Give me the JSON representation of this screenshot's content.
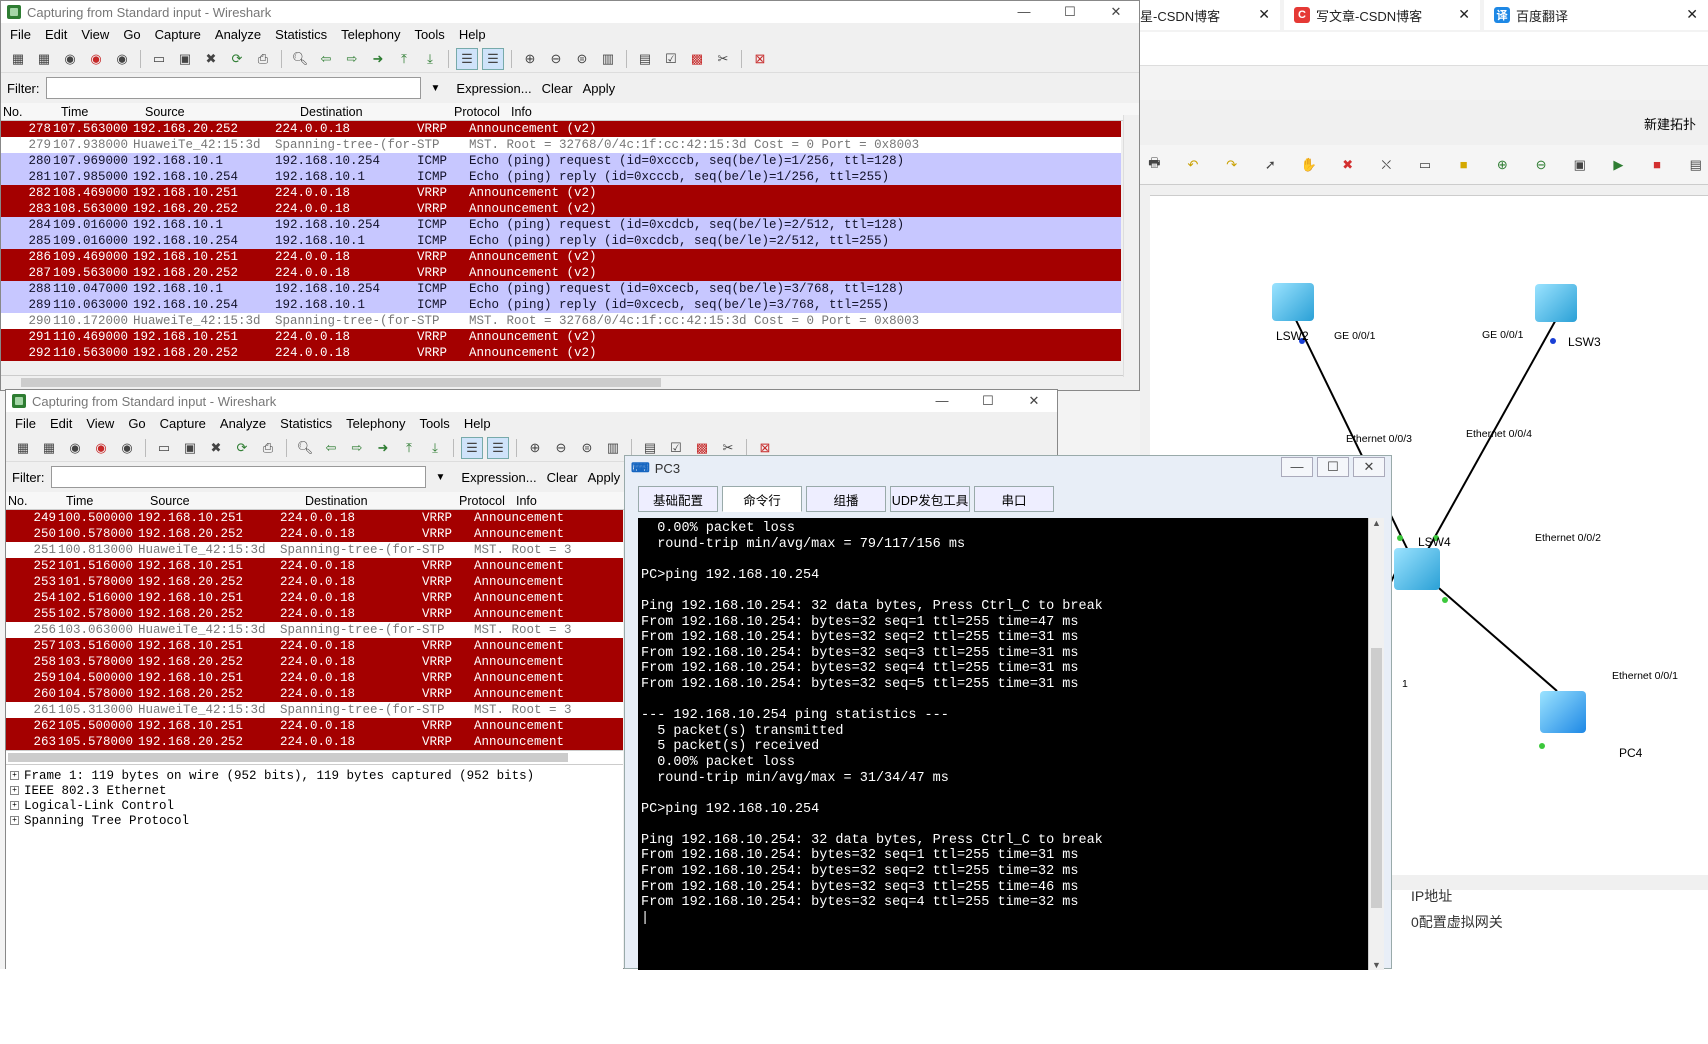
{
  "browser": {
    "tabs": [
      {
        "label": "星-CSDN博客"
      },
      {
        "label": "写文章-CSDN博客",
        "icon_text": "C",
        "icon_color": "#e53935"
      },
      {
        "label": "百度翻译",
        "icon_text": "译",
        "icon_color": "#1e88e5"
      }
    ],
    "close_glyph": "✕"
  },
  "ensp": {
    "new_topo": "新建拓扑",
    "devices": [
      {
        "name": "LSW2"
      },
      {
        "name": "LSW3"
      },
      {
        "name": "LSW4"
      },
      {
        "name": "PC4"
      }
    ],
    "ports": [
      "GE 0/0/1",
      "GE 0/0/1",
      "Ethernet 0/0/3",
      "Ethernet 0/0/4",
      "Ethernet 0/0/2",
      "Ethernet 0/0/1",
      "1"
    ],
    "bottom_texts": [
      "IP地址",
      "0配置虚拟网关"
    ]
  },
  "ws1": {
    "title": "Capturing from Standard input - Wireshark",
    "menu": [
      "File",
      "Edit",
      "View",
      "Go",
      "Capture",
      "Analyze",
      "Statistics",
      "Telephony",
      "Tools",
      "Help"
    ],
    "filter_label": "Filter:",
    "filter_value": "",
    "expression": "Expression...",
    "clear": "Clear",
    "apply": "Apply",
    "columns": [
      "No.",
      "Time",
      "Source",
      "Destination",
      "Protocol",
      "Info"
    ],
    "rows": [
      {
        "no": "278",
        "time": "107.563000",
        "src": "192.168.20.252",
        "dst": "224.0.0.18",
        "proto": "VRRP",
        "info": "Announcement (v2)",
        "type": "vrrp"
      },
      {
        "no": "279",
        "time": "107.938000",
        "src": "HuaweiTe_42:15:3d",
        "dst": "Spanning-tree-(for-",
        "proto": "STP",
        "info": "MST. Root = 32768/0/4c:1f:cc:42:15:3d  Cost = 0  Port = 0x8003",
        "type": "stp"
      },
      {
        "no": "280",
        "time": "107.969000",
        "src": "192.168.10.1",
        "dst": "192.168.10.254",
        "proto": "ICMP",
        "info": "Echo (ping) request  (id=0xcccb, seq(be/le)=1/256, ttl=128)",
        "type": "icmp"
      },
      {
        "no": "281",
        "time": "107.985000",
        "src": "192.168.10.254",
        "dst": "192.168.10.1",
        "proto": "ICMP",
        "info": "Echo (ping) reply    (id=0xcccb, seq(be/le)=1/256, ttl=255)",
        "type": "icmp"
      },
      {
        "no": "282",
        "time": "108.469000",
        "src": "192.168.10.251",
        "dst": "224.0.0.18",
        "proto": "VRRP",
        "info": "Announcement (v2)",
        "type": "vrrp"
      },
      {
        "no": "283",
        "time": "108.563000",
        "src": "192.168.20.252",
        "dst": "224.0.0.18",
        "proto": "VRRP",
        "info": "Announcement (v2)",
        "type": "vrrp"
      },
      {
        "no": "284",
        "time": "109.016000",
        "src": "192.168.10.1",
        "dst": "192.168.10.254",
        "proto": "ICMP",
        "info": "Echo (ping) request  (id=0xcdcb, seq(be/le)=2/512, ttl=128)",
        "type": "icmp"
      },
      {
        "no": "285",
        "time": "109.016000",
        "src": "192.168.10.254",
        "dst": "192.168.10.1",
        "proto": "ICMP",
        "info": "Echo (ping) reply    (id=0xcdcb, seq(be/le)=2/512, ttl=255)",
        "type": "icmp"
      },
      {
        "no": "286",
        "time": "109.469000",
        "src": "192.168.10.251",
        "dst": "224.0.0.18",
        "proto": "VRRP",
        "info": "Announcement (v2)",
        "type": "vrrp"
      },
      {
        "no": "287",
        "time": "109.563000",
        "src": "192.168.20.252",
        "dst": "224.0.0.18",
        "proto": "VRRP",
        "info": "Announcement (v2)",
        "type": "vrrp"
      },
      {
        "no": "288",
        "time": "110.047000",
        "src": "192.168.10.1",
        "dst": "192.168.10.254",
        "proto": "ICMP",
        "info": "Echo (ping) request  (id=0xcecb, seq(be/le)=3/768, ttl=128)",
        "type": "icmp"
      },
      {
        "no": "289",
        "time": "110.063000",
        "src": "192.168.10.254",
        "dst": "192.168.10.1",
        "proto": "ICMP",
        "info": "Echo (ping) reply    (id=0xcecb, seq(be/le)=3/768, ttl=255)",
        "type": "icmp"
      },
      {
        "no": "290",
        "time": "110.172000",
        "src": "HuaweiTe_42:15:3d",
        "dst": "Spanning-tree-(for-",
        "proto": "STP",
        "info": "MST. Root = 32768/0/4c:1f:cc:42:15:3d  Cost = 0  Port = 0x8003",
        "type": "stp"
      },
      {
        "no": "291",
        "time": "110.469000",
        "src": "192.168.10.251",
        "dst": "224.0.0.18",
        "proto": "VRRP",
        "info": "Announcement (v2)",
        "type": "vrrp"
      },
      {
        "no": "292",
        "time": "110.563000",
        "src": "192.168.20.252",
        "dst": "224.0.0.18",
        "proto": "VRRP",
        "info": "Announcement (v2)",
        "type": "vrrp"
      }
    ]
  },
  "ws2": {
    "title": "Capturing from Standard input - Wireshark",
    "menu": [
      "File",
      "Edit",
      "View",
      "Go",
      "Capture",
      "Analyze",
      "Statistics",
      "Telephony",
      "Tools",
      "Help"
    ],
    "filter_label": "Filter:",
    "filter_value": "",
    "expression": "Expression...",
    "clear": "Clear",
    "apply": "Apply",
    "columns": [
      "No.",
      "Time",
      "Source",
      "Destination",
      "Protocol",
      "Info"
    ],
    "rows": [
      {
        "no": "249",
        "time": "100.500000",
        "src": "192.168.10.251",
        "dst": "224.0.0.18",
        "proto": "VRRP",
        "info": "Announcement",
        "type": "vrrp"
      },
      {
        "no": "250",
        "time": "100.578000",
        "src": "192.168.20.252",
        "dst": "224.0.0.18",
        "proto": "VRRP",
        "info": "Announcement",
        "type": "vrrp"
      },
      {
        "no": "251",
        "time": "100.813000",
        "src": "HuaweiTe_42:15:3d",
        "dst": "Spanning-tree-(for-",
        "proto": "STP",
        "info": "MST. Root = 3",
        "type": "stp"
      },
      {
        "no": "252",
        "time": "101.516000",
        "src": "192.168.10.251",
        "dst": "224.0.0.18",
        "proto": "VRRP",
        "info": "Announcement",
        "type": "vrrp"
      },
      {
        "no": "253",
        "time": "101.578000",
        "src": "192.168.20.252",
        "dst": "224.0.0.18",
        "proto": "VRRP",
        "info": "Announcement",
        "type": "vrrp"
      },
      {
        "no": "254",
        "time": "102.516000",
        "src": "192.168.10.251",
        "dst": "224.0.0.18",
        "proto": "VRRP",
        "info": "Announcement",
        "type": "vrrp"
      },
      {
        "no": "255",
        "time": "102.578000",
        "src": "192.168.20.252",
        "dst": "224.0.0.18",
        "proto": "VRRP",
        "info": "Announcement",
        "type": "vrrp"
      },
      {
        "no": "256",
        "time": "103.063000",
        "src": "HuaweiTe_42:15:3d",
        "dst": "Spanning-tree-(for-",
        "proto": "STP",
        "info": "MST. Root = 3",
        "type": "stp"
      },
      {
        "no": "257",
        "time": "103.516000",
        "src": "192.168.10.251",
        "dst": "224.0.0.18",
        "proto": "VRRP",
        "info": "Announcement",
        "type": "vrrp"
      },
      {
        "no": "258",
        "time": "103.578000",
        "src": "192.168.20.252",
        "dst": "224.0.0.18",
        "proto": "VRRP",
        "info": "Announcement",
        "type": "vrrp"
      },
      {
        "no": "259",
        "time": "104.500000",
        "src": "192.168.10.251",
        "dst": "224.0.0.18",
        "proto": "VRRP",
        "info": "Announcement",
        "type": "vrrp"
      },
      {
        "no": "260",
        "time": "104.578000",
        "src": "192.168.20.252",
        "dst": "224.0.0.18",
        "proto": "VRRP",
        "info": "Announcement",
        "type": "vrrp"
      },
      {
        "no": "261",
        "time": "105.313000",
        "src": "HuaweiTe_42:15:3d",
        "dst": "Spanning-tree-(for-",
        "proto": "STP",
        "info": "MST. Root = 3",
        "type": "stp"
      },
      {
        "no": "262",
        "time": "105.500000",
        "src": "192.168.10.251",
        "dst": "224.0.0.18",
        "proto": "VRRP",
        "info": "Announcement",
        "type": "vrrp"
      },
      {
        "no": "263",
        "time": "105.578000",
        "src": "192.168.20.252",
        "dst": "224.0.0.18",
        "proto": "VRRP",
        "info": "Announcement",
        "type": "vrrp"
      }
    ],
    "details": [
      "Frame 1: 119 bytes on wire (952 bits), 119 bytes captured (952 bits)",
      "IEEE 802.3 Ethernet",
      "Logical-Link Control",
      "Spanning Tree Protocol"
    ]
  },
  "pc3": {
    "title": "PC3",
    "tabs": [
      "基础配置",
      "命令行",
      "组播",
      "UDP发包工具",
      "串口"
    ],
    "console_lines": [
      "  0.00% packet loss",
      "  round-trip min/avg/max = 79/117/156 ms",
      "",
      "PC>ping 192.168.10.254",
      "",
      "Ping 192.168.10.254: 32 data bytes, Press Ctrl_C to break",
      "From 192.168.10.254: bytes=32 seq=1 ttl=255 time=47 ms",
      "From 192.168.10.254: bytes=32 seq=2 ttl=255 time=31 ms",
      "From 192.168.10.254: bytes=32 seq=3 ttl=255 time=31 ms",
      "From 192.168.10.254: bytes=32 seq=4 ttl=255 time=31 ms",
      "From 192.168.10.254: bytes=32 seq=5 ttl=255 time=31 ms",
      "",
      "--- 192.168.10.254 ping statistics ---",
      "  5 packet(s) transmitted",
      "  5 packet(s) received",
      "  0.00% packet loss",
      "  round-trip min/avg/max = 31/34/47 ms",
      "",
      "PC>ping 192.168.10.254",
      "",
      "Ping 192.168.10.254: 32 data bytes, Press Ctrl_C to break",
      "From 192.168.10.254: bytes=32 seq=1 ttl=255 time=31 ms",
      "From 192.168.10.254: bytes=32 seq=2 ttl=255 time=32 ms",
      "From 192.168.10.254: bytes=32 seq=3 ttl=255 time=46 ms",
      "From 192.168.10.254: bytes=32 seq=4 ttl=255 time=32 ms",
      "|"
    ]
  },
  "colors": {
    "vrrp": "#a40000",
    "icmp": "#c7c7ff",
    "stp": "#ffffff"
  }
}
